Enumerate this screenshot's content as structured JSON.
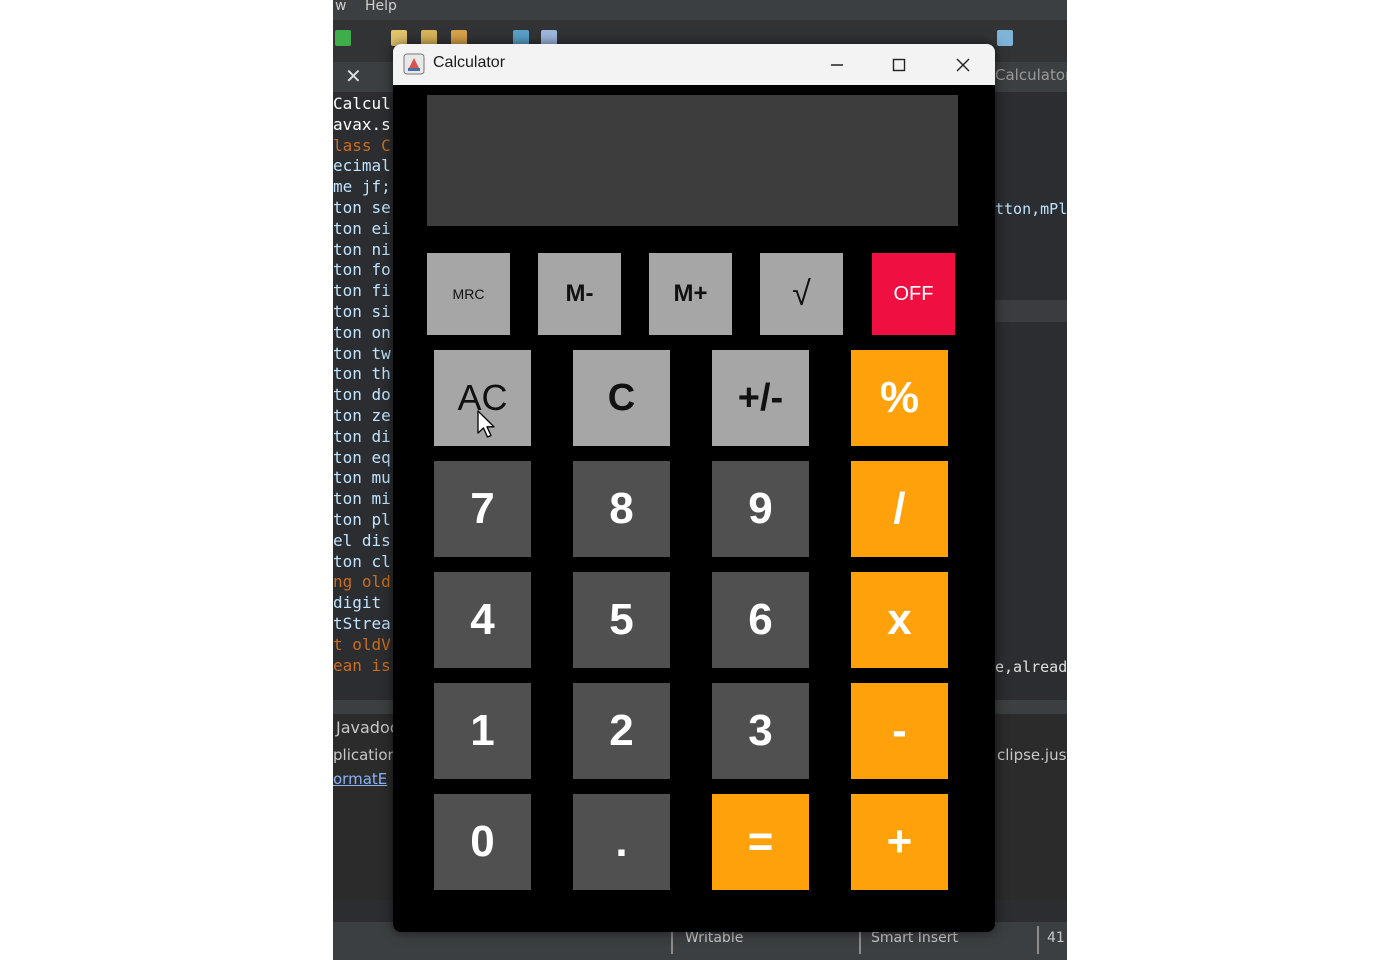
{
  "ide": {
    "menu": [
      "w",
      "Help"
    ],
    "right_tab": "Calculator",
    "code_lines": [
      {
        "text": "Calcul",
        "color": "#ffffff"
      },
      {
        "text": "avax.s",
        "color": "#ffffff"
      },
      {
        "text": "lass C",
        "color": "#cc6c1d"
      },
      {
        "text": "ecimal",
        "color": "#bfe4ff"
      },
      {
        "text": "me jf;",
        "color": "#bfe4ff"
      },
      {
        "text": "ton se",
        "color": "#bfe4ff"
      },
      {
        "text": "ton ei",
        "color": "#bfe4ff"
      },
      {
        "text": "ton ni",
        "color": "#bfe4ff"
      },
      {
        "text": "ton fo",
        "color": "#bfe4ff"
      },
      {
        "text": "ton fi",
        "color": "#bfe4ff"
      },
      {
        "text": "ton si",
        "color": "#bfe4ff"
      },
      {
        "text": "ton on",
        "color": "#bfe4ff"
      },
      {
        "text": "ton tw",
        "color": "#bfe4ff"
      },
      {
        "text": "ton th",
        "color": "#bfe4ff"
      },
      {
        "text": "ton do",
        "color": "#bfe4ff"
      },
      {
        "text": "ton ze",
        "color": "#bfe4ff"
      },
      {
        "text": "ton di",
        "color": "#bfe4ff"
      },
      {
        "text": "ton eq",
        "color": "#bfe4ff"
      },
      {
        "text": "ton mu",
        "color": "#bfe4ff"
      },
      {
        "text": "ton mi",
        "color": "#bfe4ff"
      },
      {
        "text": "ton pl",
        "color": "#bfe4ff"
      },
      {
        "text": "el dis",
        "color": "#bfe4ff"
      },
      {
        "text": "ton cl",
        "color": "#bfe4ff"
      },
      {
        "text": "ng old",
        "color": "#cc6c1d"
      },
      {
        "text": " digit",
        "color": "#bfe4ff"
      },
      {
        "text": "tStrea",
        "color": "#bfe4ff"
      },
      {
        "text": "t oldV",
        "color": "#cc6c1d"
      },
      {
        "text": "ean is",
        "color": "#cc6c1d"
      }
    ],
    "right_code_top": "tton,mPl",
    "right_code_bottom": "e,alread",
    "bottom_left": [
      "Javadoc",
      "plication",
      "ormatE"
    ],
    "bottom_right": "clipse.justj",
    "status": {
      "writable": "Writable",
      "insert": "Smart Insert",
      "position": "41"
    }
  },
  "window": {
    "title": "Calculator",
    "display": ""
  },
  "memory_keys": [
    {
      "label": "MRC",
      "name": "mrc-button"
    },
    {
      "label": "M-",
      "name": "m-minus-button"
    },
    {
      "label": "M+",
      "name": "m-plus-button"
    },
    {
      "label": "√",
      "name": "sqrt-button"
    },
    {
      "label": "OFF",
      "name": "off-button"
    }
  ],
  "keys": [
    [
      {
        "label": "AC",
        "style": "light",
        "name": "ac-button"
      },
      {
        "label": "C",
        "style": "light",
        "name": "c-button"
      },
      {
        "label": "+/-",
        "style": "light",
        "name": "sign-button"
      },
      {
        "label": "%",
        "style": "orange",
        "name": "percent-button"
      }
    ],
    [
      {
        "label": "7",
        "style": "dark",
        "name": "seven-button"
      },
      {
        "label": "8",
        "style": "dark",
        "name": "eight-button"
      },
      {
        "label": "9",
        "style": "dark",
        "name": "nine-button"
      },
      {
        "label": "/",
        "style": "orange",
        "name": "divide-button"
      }
    ],
    [
      {
        "label": "4",
        "style": "dark",
        "name": "four-button"
      },
      {
        "label": "5",
        "style": "dark",
        "name": "five-button"
      },
      {
        "label": "6",
        "style": "dark",
        "name": "six-button"
      },
      {
        "label": "x",
        "style": "orange",
        "name": "multiply-button"
      }
    ],
    [
      {
        "label": "1",
        "style": "dark",
        "name": "one-button"
      },
      {
        "label": "2",
        "style": "dark",
        "name": "two-button"
      },
      {
        "label": "3",
        "style": "dark",
        "name": "three-button"
      },
      {
        "label": "-",
        "style": "orange",
        "name": "minus-button"
      }
    ],
    [
      {
        "label": "0",
        "style": "dark",
        "name": "zero-button"
      },
      {
        "label": ".",
        "style": "dark",
        "name": "decimal-button"
      },
      {
        "label": "=",
        "style": "orange",
        "name": "equals-button"
      },
      {
        "label": "+",
        "style": "orange",
        "name": "plus-button"
      }
    ]
  ],
  "colors": {
    "light_key": "#a6a6a6",
    "dark_key": "#505050",
    "orange_key": "#ffa10a",
    "off_key": "#ef0f41",
    "display": "#3d3d3d"
  }
}
